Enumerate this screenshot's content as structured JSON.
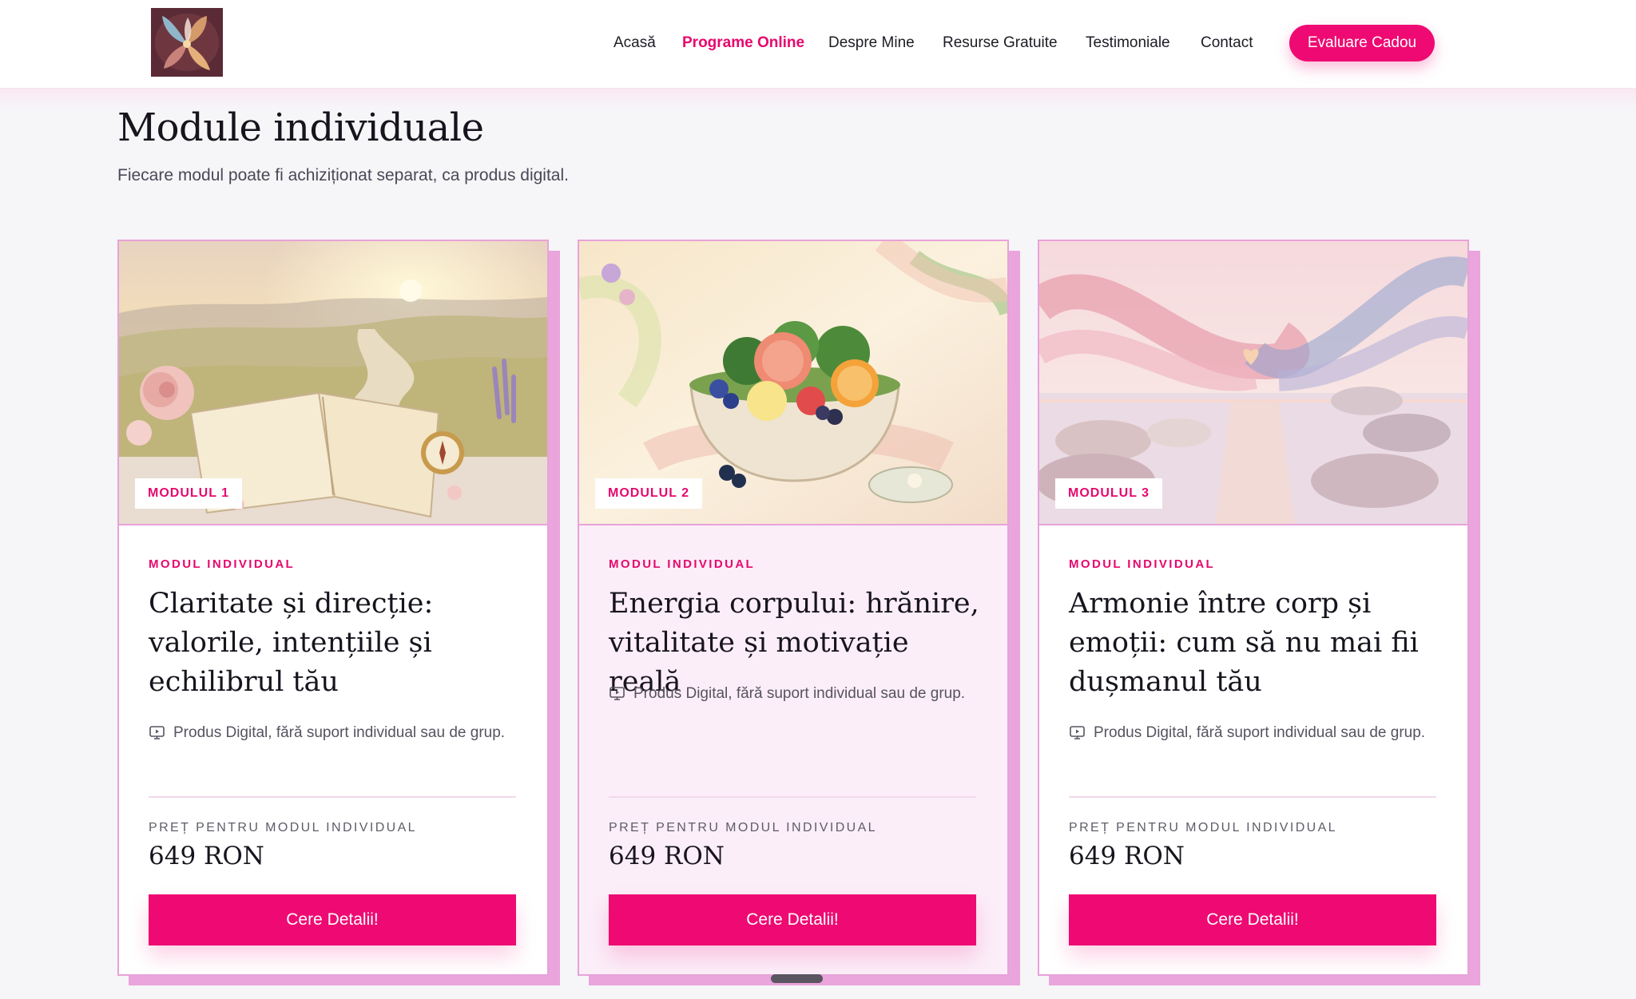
{
  "header": {
    "logo_icon": "lotus-logo-icon",
    "nav": [
      {
        "label": "Acasă",
        "active": false
      },
      {
        "label": "Programe Online",
        "active": true
      },
      {
        "label": "Despre Mine",
        "active": false
      },
      {
        "label": "Resurse Gratuite",
        "active": false
      },
      {
        "label": "Testimoniale",
        "active": false
      },
      {
        "label": "Contact",
        "active": false
      }
    ],
    "cta_label": "Evaluare Cadou"
  },
  "section": {
    "title": "Module individuale",
    "subtitle": "Fiecare modul poate fi achiziționat separat, ca produs digital."
  },
  "cards": [
    {
      "badge": "MODULUL 1",
      "eyebrow": "MODUL INDIVIDUAL",
      "title": "Claritate și direcție: valorile, intențiile și echilibrul tău",
      "note": "Produs Digital, fără suport individual sau de grup.",
      "note_icon": "monitor-play-icon",
      "price_label": "PREȚ PENTRU MODUL INDIVIDUAL",
      "price": "649 RON",
      "button_label": "Cere Detalii!"
    },
    {
      "badge": "MODULUL 2",
      "eyebrow": "MODUL INDIVIDUAL",
      "title": "Energia corpului: hrănire, vitalitate și motivație reală",
      "note": "Produs Digital, fără suport individual sau de grup.",
      "note_icon": "monitor-play-icon",
      "price_label": "PREȚ PENTRU MODUL INDIVIDUAL",
      "price": "649 RON",
      "button_label": "Cere Detalii!"
    },
    {
      "badge": "MODULUL 3",
      "eyebrow": "MODUL INDIVIDUAL",
      "title": "Armonie între corp și emoții: cum să nu mai fii dușmanul tău",
      "note": "Produs Digital, fără suport individual sau de grup.",
      "note_icon": "monitor-play-icon",
      "price_label": "PREȚ PENTRU MODUL INDIVIDUAL",
      "price": "649 RON",
      "button_label": "Cere Detalii!"
    }
  ],
  "colors": {
    "accent": "#ee0a72",
    "card_border": "#e8a2d9",
    "card_shadow": "#eaa5dc",
    "page_bg": "#f6f5f8"
  }
}
